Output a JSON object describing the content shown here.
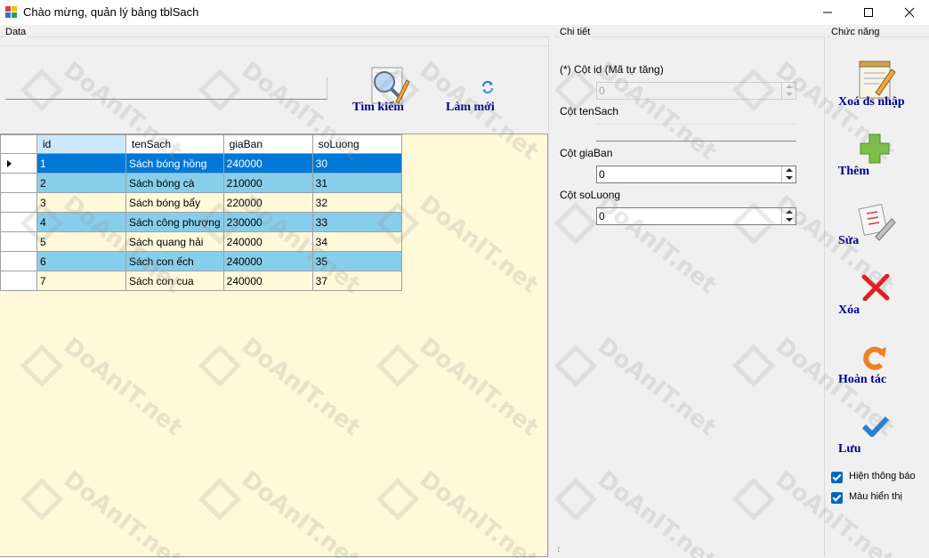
{
  "window": {
    "title": "Chào mừng, quản lý bảng tblSach",
    "controls": [
      "minimize-icon",
      "maximize-icon",
      "close-icon"
    ]
  },
  "data_group": {
    "label": "Data",
    "search": {
      "value": "",
      "placeholder": ""
    },
    "buttons": {
      "search_label": "Tìm kiếm",
      "refresh_label": "Làm mới"
    },
    "grid": {
      "columns": [
        "id",
        "tenSach",
        "giaBan",
        "soLuong"
      ],
      "rows": [
        [
          "1",
          "Sách bóng hồng",
          "240000",
          "30"
        ],
        [
          "2",
          "Sách bóng cà",
          "210000",
          "31"
        ],
        [
          "3",
          "Sách bóng bẩy",
          "220000",
          "32"
        ],
        [
          "4",
          "Sách công phượng",
          "230000",
          "33"
        ],
        [
          "5",
          "Sách quang hải",
          "240000",
          "34"
        ],
        [
          "6",
          "Sách con ếch",
          "240000",
          "35"
        ],
        [
          "7",
          "Sách con cua",
          "240000",
          "37"
        ]
      ],
      "selected_row_index": 0,
      "colors": {
        "selected": "#0078d7",
        "alternate": "#87ceeb",
        "background": "#fff8d9"
      }
    }
  },
  "detail_group": {
    "label": "Chi tiết",
    "fields": {
      "id_label": "(*) Cột id (Mã tự tăng)",
      "id_value": "0",
      "tensach_label": "Cột tenSach",
      "tensach_value": "",
      "giaban_label": "Cột giaBan",
      "giaban_value": "0",
      "soluong_label": "Cột soLuong",
      "soluong_value": "0"
    }
  },
  "function_group": {
    "label": "Chức năng",
    "buttons": {
      "clear_label": "Xoá ds nhập",
      "add_label": "Thêm",
      "edit_label": "Sửa",
      "delete_label": "Xóa",
      "undo_label": "Hoàn tác",
      "save_label": "Lưu"
    },
    "checkboxes": {
      "show_message_label": "Hiện thông báo",
      "show_message_checked": true,
      "display_color_label": "Màu hiển thị",
      "display_color_checked": true
    }
  },
  "watermark": "DoAnIT.net"
}
